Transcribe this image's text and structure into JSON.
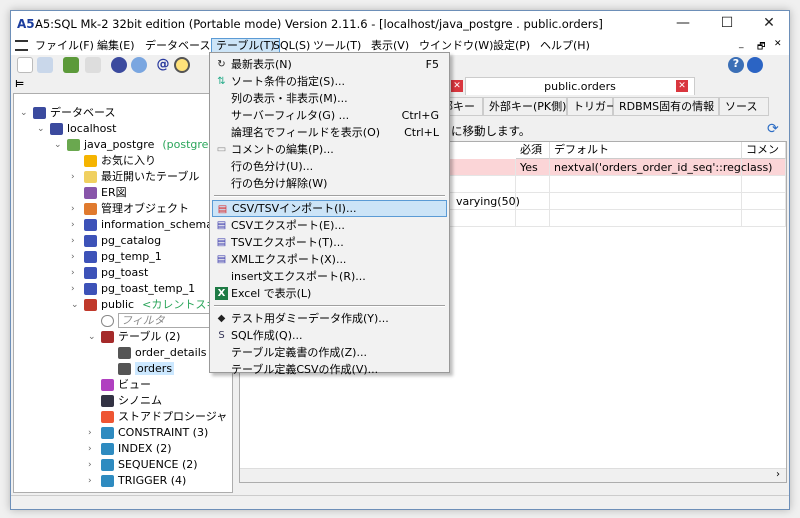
{
  "window": {
    "title": "A5:SQL Mk-2 32bit edition (Portable mode) Version 2.11.6 - [localhost/java_postgre . public.orders]",
    "logo": "A5",
    "minimize": "—",
    "maximize": "☐",
    "close": "✕"
  },
  "menubar": [
    "ファイル(F)",
    "編集(E)",
    "データベース(D)",
    "テーブル(T)",
    "SQL(S)",
    "ツール(T)",
    "表示(V)",
    "ウインドウ(W)",
    "設定(P)",
    "ヘルプ(H)"
  ],
  "menubar_open": "テーブル(T)",
  "mdi_controls": [
    "_",
    "🗗",
    "✕"
  ],
  "tree": [
    {
      "label": "データベース",
      "level": 0,
      "expand": "v",
      "icon": "database-icon"
    },
    {
      "label": "localhost",
      "level": 1,
      "expand": "v",
      "icon": "server-icon"
    },
    {
      "label": "java_postgre",
      "extra": "(postgres)",
      "level": 2,
      "expand": "v",
      "icon": "db-icon"
    },
    {
      "label": "お気に入り",
      "level": 3,
      "expand": "",
      "icon": "star-icon"
    },
    {
      "label": "最近開いたテーブル",
      "level": 3,
      "expand": ">",
      "icon": "clock-icon"
    },
    {
      "label": "ER図",
      "level": 3,
      "expand": "",
      "icon": "er-diagram-icon"
    },
    {
      "label": "管理オブジェクト",
      "level": 3,
      "expand": ">",
      "icon": "admin-objects-icon"
    },
    {
      "label": "information_schema",
      "level": 3,
      "expand": ">",
      "icon": "schema-icon"
    },
    {
      "label": "pg_catalog",
      "level": 3,
      "expand": ">",
      "icon": "schema-icon"
    },
    {
      "label": "pg_temp_1",
      "level": 3,
      "expand": ">",
      "icon": "schema-icon"
    },
    {
      "label": "pg_toast",
      "level": 3,
      "expand": ">",
      "icon": "schema-icon"
    },
    {
      "label": "pg_toast_temp_1",
      "level": 3,
      "expand": ">",
      "icon": "schema-icon"
    },
    {
      "label": "public",
      "extra": "<カレントスキー",
      "level": 3,
      "expand": "v",
      "icon": "schema-current-icon"
    },
    {
      "label": "フィルタ",
      "level": 4,
      "expand": "",
      "icon": "search-icon",
      "filter": true
    },
    {
      "label": "テーブル (2)",
      "level": 4,
      "expand": "v",
      "icon": "tables-icon"
    },
    {
      "label": "order_details",
      "level": 5,
      "expand": "",
      "icon": "table-icon"
    },
    {
      "label": "orders",
      "level": 5,
      "expand": "",
      "icon": "table-icon",
      "selected": true
    },
    {
      "label": "ビュー",
      "level": 4,
      "expand": "",
      "icon": "view-icon"
    },
    {
      "label": "シノニム",
      "level": 4,
      "expand": "",
      "icon": "synonym-icon"
    },
    {
      "label": "ストアドプロシージャ",
      "level": 4,
      "expand": "",
      "icon": "procedure-icon"
    },
    {
      "label": "CONSTRAINT (3)",
      "level": 4,
      "expand": ">",
      "icon": "constraint-icon"
    },
    {
      "label": "INDEX (2)",
      "level": 4,
      "expand": ">",
      "icon": "index-icon"
    },
    {
      "label": "SEQUENCE (2)",
      "level": 4,
      "expand": ">",
      "icon": "sequence-icon"
    },
    {
      "label": "TRIGGER (4)",
      "level": 4,
      "expand": ">",
      "icon": "trigger-icon"
    }
  ],
  "doc_tab": {
    "label": "public.orders"
  },
  "subtabs": [
    "外部キー",
    "外部キー(PK側)",
    "トリガー",
    "RDBMS固有の情報",
    "ソース"
  ],
  "info_text": "に移動します。",
  "grid": {
    "headers": [
      "必須",
      "デフォルト",
      "コメント"
    ],
    "rows": [
      {
        "type": "",
        "required": "Yes",
        "default": "nextval('orders_order_id_seq'::regclass)",
        "comment": "",
        "highlight": true
      },
      {
        "type": "",
        "required": "",
        "default": "",
        "comment": ""
      },
      {
        "type": "varying(50)",
        "required": "",
        "default": "",
        "comment": ""
      },
      {
        "type": "",
        "required": "",
        "default": "",
        "comment": ""
      }
    ]
  },
  "menu": {
    "items": [
      {
        "label": "最新表示(N)",
        "shortcut": "F5",
        "icon": "refresh-icon"
      },
      {
        "label": "ソート条件の指定(S)...",
        "shortcut": "",
        "icon": "sort-icon"
      },
      {
        "label": "列の表示・非表示(M)...",
        "shortcut": "",
        "icon": ""
      },
      {
        "label": "サーバーフィルタ(G) ...",
        "shortcut": "Ctrl+G",
        "icon": ""
      },
      {
        "label": "論理名でフィールドを表示(O)",
        "shortcut": "Ctrl+L",
        "icon": ""
      },
      {
        "label": "コメントの編集(P)...",
        "shortcut": "",
        "icon": "comment-icon"
      },
      {
        "label": "行の色分け(U)...",
        "shortcut": "",
        "icon": ""
      },
      {
        "label": "行の色分け解除(W)",
        "shortcut": "",
        "icon": ""
      },
      {
        "sep": true
      },
      {
        "label": "CSV/TSVインポート(I)...",
        "shortcut": "",
        "icon": "import-icon",
        "highlight": true
      },
      {
        "label": "CSVエクスポート(E)...",
        "shortcut": "",
        "icon": "csv-export-icon"
      },
      {
        "label": "TSVエクスポート(T)...",
        "shortcut": "",
        "icon": "tsv-export-icon"
      },
      {
        "label": "XMLエクスポート(X)...",
        "shortcut": "",
        "icon": "xml-export-icon"
      },
      {
        "label": "insert文エクスポート(R)...",
        "shortcut": "",
        "icon": ""
      },
      {
        "label": "Excel で表示(L)",
        "shortcut": "",
        "icon": "excel-icon"
      },
      {
        "sep": true
      },
      {
        "label": "テスト用ダミーデータ作成(Y)...",
        "shortcut": "",
        "icon": "dummy-data-icon"
      },
      {
        "label": "SQL作成(Q)...",
        "shortcut": "",
        "icon": "sql-icon"
      },
      {
        "label": "テーブル定義書の作成(Z)...",
        "shortcut": "",
        "icon": ""
      },
      {
        "label": "テーブル定義CSVの作成(V)...",
        "shortcut": "",
        "icon": ""
      }
    ]
  },
  "colors": {
    "highlight_row": "#fbd5d7",
    "menu_highlight": "#cce4f7",
    "accent": "#5b9bd5",
    "schema_note": "#2aa55a"
  }
}
